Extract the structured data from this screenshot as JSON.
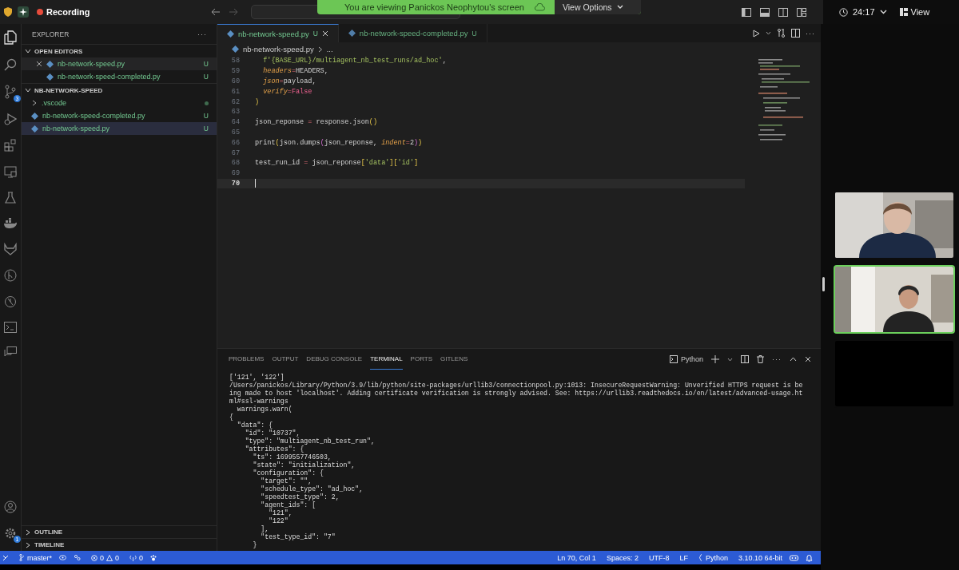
{
  "meeting_bar": {
    "recording_label": "Recording",
    "banner": "You are viewing Panickos Neophytou's screen",
    "view_options": "View Options",
    "timer": "24:17",
    "view_button": "View"
  },
  "activity_bar": {
    "source_control_badge": "3",
    "settings_badge": "1"
  },
  "sidebar": {
    "title": "EXPLORER",
    "more": "···",
    "open_editors": {
      "title": "OPEN EDITORS",
      "expanded": true,
      "items": [
        {
          "label": "nb-network-speed.py",
          "status": "U",
          "active": true
        },
        {
          "label": "nb-network-speed-completed.py",
          "status": "U",
          "active": false
        }
      ]
    },
    "folder": {
      "title": "NB-NETWORK-SPEED",
      "expanded": true,
      "items": [
        {
          "label": ".vscode",
          "kind": "folder",
          "expanded": false,
          "selected": false
        },
        {
          "label": "nb-network-speed-completed.py",
          "kind": "file",
          "status": "U",
          "selected": false
        },
        {
          "label": "nb-network-speed.py",
          "kind": "file",
          "status": "U",
          "selected": true
        }
      ]
    },
    "bottom_sections": [
      {
        "title": "OUTLINE",
        "expanded": false
      },
      {
        "title": "TIMELINE",
        "expanded": false
      }
    ]
  },
  "editor": {
    "tabs": [
      {
        "label": "nb-network-speed.py",
        "status": "U",
        "selected": true
      },
      {
        "label": "nb-network-speed-completed.py",
        "status": "U",
        "selected": false
      }
    ],
    "breadcrumb": [
      "nb-network-speed.py",
      "..."
    ],
    "lines": [
      {
        "number": "58",
        "indented": true,
        "tokens": [
          {
            "text": "f'{BASE_URL}/multiagent_nb_test_runs/ad_hoc'",
            "kind": "string"
          },
          {
            "text": ","
          }
        ]
      },
      {
        "number": "59",
        "indented": true,
        "tokens": [
          {
            "text": "headers",
            "kind": "param"
          },
          {
            "text": "=",
            "kind": "op"
          },
          {
            "text": "HEADERS,"
          }
        ]
      },
      {
        "number": "60",
        "indented": true,
        "tokens": [
          {
            "text": "json",
            "kind": "param"
          },
          {
            "text": "=",
            "kind": "op"
          },
          {
            "text": "payload,"
          }
        ]
      },
      {
        "number": "61",
        "indented": true,
        "tokens": [
          {
            "text": "verify",
            "kind": "param"
          },
          {
            "text": "=",
            "kind": "op"
          },
          {
            "text": "False",
            "kind": "const"
          }
        ]
      },
      {
        "number": "62",
        "tokens": [
          {
            "text": ")",
            "kind": "bracket"
          }
        ]
      },
      {
        "number": "63"
      },
      {
        "number": "64",
        "tokens": [
          {
            "text": "json_reponse "
          },
          {
            "text": "=",
            "kind": "op"
          },
          {
            "text": " response.json"
          },
          {
            "text": "()",
            "kind": "bracket"
          }
        ]
      },
      {
        "number": "65"
      },
      {
        "number": "66",
        "tokens": [
          {
            "text": "print"
          },
          {
            "text": "(",
            "kind": "bracket"
          },
          {
            "text": "json.dumps"
          },
          {
            "text": "(",
            "kind": "bracket2"
          },
          {
            "text": "json_reponse, "
          },
          {
            "text": "indent",
            "kind": "param"
          },
          {
            "text": "=",
            "kind": "op"
          },
          {
            "text": "2"
          },
          {
            "text": ")",
            "kind": "bracket2"
          },
          {
            "text": ")",
            "kind": "bracket"
          }
        ]
      },
      {
        "number": "67"
      },
      {
        "number": "68",
        "tokens": [
          {
            "text": "test_run_id "
          },
          {
            "text": "=",
            "kind": "op"
          },
          {
            "text": " json_reponse"
          },
          {
            "text": "[",
            "kind": "bracket"
          },
          {
            "text": "'data'",
            "kind": "string"
          },
          {
            "text": "]",
            "kind": "bracket"
          },
          {
            "text": "[",
            "kind": "bracket"
          },
          {
            "text": "'id'",
            "kind": "string"
          },
          {
            "text": "]",
            "kind": "bracket"
          }
        ]
      },
      {
        "number": "69"
      },
      {
        "number": "70",
        "current": true
      }
    ]
  },
  "panel": {
    "tabs": [
      {
        "label": "PROBLEMS",
        "selected": false
      },
      {
        "label": "OUTPUT",
        "selected": false
      },
      {
        "label": "DEBUG CONSOLE",
        "selected": false
      },
      {
        "label": "TERMINAL",
        "selected": true
      },
      {
        "label": "PORTS",
        "selected": false
      },
      {
        "label": "GITLENS",
        "selected": false
      }
    ],
    "shell": "Python",
    "terminal_lines": [
      "['121', '122']",
      "/Users/panickos/Library/Python/3.9/lib/python/site-packages/urllib3/connectionpool.py:1013: InsecureRequestWarning: Unverified HTTPS request is be",
      "ing made to host 'localhost'. Adding certificate verification is strongly advised. See: https://urllib3.readthedocs.io/en/latest/advanced-usage.ht",
      "ml#ssl-warnings",
      "  warnings.warn(",
      "{",
      "  \"data\": {",
      "    \"id\": \"10737\",",
      "    \"type\": \"multiagent_nb_test_run\",",
      "    \"attributes\": {",
      "      \"ts\": 1699557746503,",
      "      \"state\": \"initialization\",",
      "      \"configuration\": {",
      "        \"target\": \"\",",
      "        \"schedule_type\": \"ad_hoc\",",
      "        \"speedtest_type\": 2,",
      "        \"agent_ids\": [",
      "          \"121\",",
      "          \"122\"",
      "        ],",
      "        \"test_type_id\": \"7\"",
      "      }"
    ]
  },
  "status_bar": {
    "branch": "master*",
    "errors": "0",
    "warnings": "0",
    "ports": "0",
    "right": [
      "Ln 70, Col 1",
      "Spaces: 2",
      "UTF-8",
      "LF",
      "Python",
      "3.10.10 64-bit"
    ]
  },
  "video_tiles": [
    {
      "kind": "picture",
      "selected": false
    },
    {
      "kind": "picture",
      "selected": true
    },
    {
      "kind": "empty",
      "selected": false
    }
  ]
}
